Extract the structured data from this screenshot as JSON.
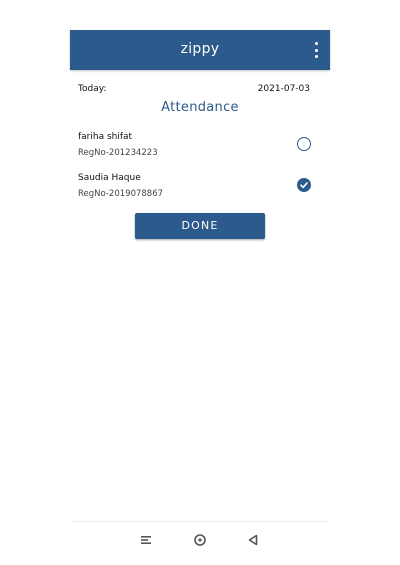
{
  "app": {
    "title": "zippy",
    "menu_icon": "more-vert-icon",
    "brand_color": "#2d5a8c"
  },
  "header": {
    "today_label": "Today:",
    "date": "2021-07-03",
    "heading": "Attendance"
  },
  "students": [
    {
      "name": "fariha shifat",
      "reg": "RegNo-201234223",
      "present": false
    },
    {
      "name": "Saudia Haque",
      "reg": "RegNo-2019078867",
      "present": true
    }
  ],
  "actions": {
    "done_label": "DONE"
  },
  "navbar": {
    "icons": [
      "menu-icon",
      "home-icon",
      "back-icon"
    ]
  }
}
